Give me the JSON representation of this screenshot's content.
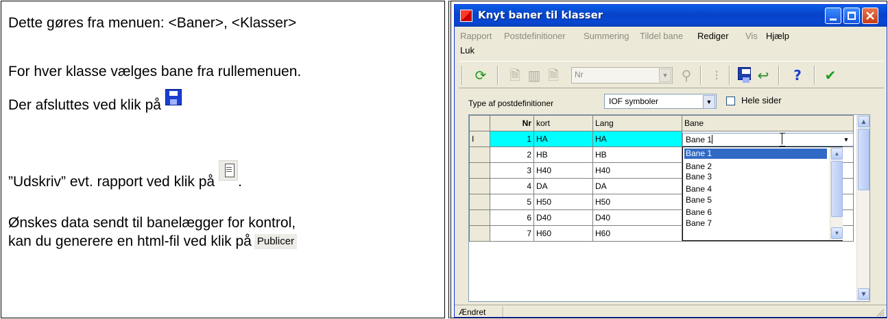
{
  "doc": {
    "line1": "Dette gøres fra menuen: <Baner>, <Klasser>",
    "line2": "For hver klasse vælges bane fra rullemenuen.",
    "line3": "Der afsluttes ved klik på",
    "line4": "”Udskriv” evt. rapport ved klik på",
    "line4_end": ".",
    "line5": "Ønskes data sendt til banelægger for kontrol,",
    "line6": "kan du generere en html-fil ved klik på",
    "publicer": "Publicer"
  },
  "window": {
    "title": "Knyt baner til klasser",
    "menu": [
      {
        "label": "Rapport",
        "enabled": false
      },
      {
        "label": "Postdefinitioner",
        "enabled": false
      },
      {
        "label": "Summering",
        "enabled": false
      },
      {
        "label": "Tildel bane",
        "enabled": false
      },
      {
        "label": "Rediger",
        "enabled": true
      },
      {
        "label": "Vis",
        "enabled": false
      },
      {
        "label": "Hjælp",
        "enabled": true
      },
      {
        "label": "Luk",
        "enabled": true
      }
    ],
    "toolbar": {
      "nr_placeholder": "Nr",
      "icons": [
        "refresh-icon",
        "document-icon",
        "document-icon",
        "document-icon",
        "search-icon",
        "grid-icon",
        "save-icon",
        "undo-icon",
        "help-icon",
        "check-icon"
      ]
    },
    "filter": {
      "type_label": "Type af postdefinitioner",
      "type_value": "IOF symboler",
      "hele_label": "Hele sider",
      "hele_checked": false
    },
    "grid": {
      "headers": {
        "nr": "Nr",
        "kort": "kort",
        "lang": "Lang",
        "bane": "Bane"
      },
      "rows": [
        {
          "nr": "1",
          "kort": "HA",
          "lang": "HA",
          "bane": ""
        },
        {
          "nr": "2",
          "kort": "HB",
          "lang": "HB",
          "bane": ""
        },
        {
          "nr": "3",
          "kort": "H40",
          "lang": "H40",
          "bane": ""
        },
        {
          "nr": "4",
          "kort": "DA",
          "lang": "DA",
          "bane": ""
        },
        {
          "nr": "5",
          "kort": "H50",
          "lang": "H50",
          "bane": ""
        },
        {
          "nr": "6",
          "kort": "D40",
          "lang": "D40",
          "bane": ""
        },
        {
          "nr": "7",
          "kort": "H60",
          "lang": "H60",
          "bane": ""
        }
      ],
      "row_indicator": "I",
      "editor_value": "Bane 1",
      "dropdown_options": [
        "Bane 1",
        "Bane 2",
        "Bane 3",
        "Bane 4",
        "Bane 5",
        "Bane 6",
        "Bane 7"
      ],
      "dropdown_selected": "Bane 1"
    },
    "status": "Ændret"
  },
  "colors": {
    "titlebar": "#0a5fe8",
    "selected_row": "#00ffff",
    "dropdown_highlight": "#316ac5",
    "window_bg": "#ece9d8"
  }
}
